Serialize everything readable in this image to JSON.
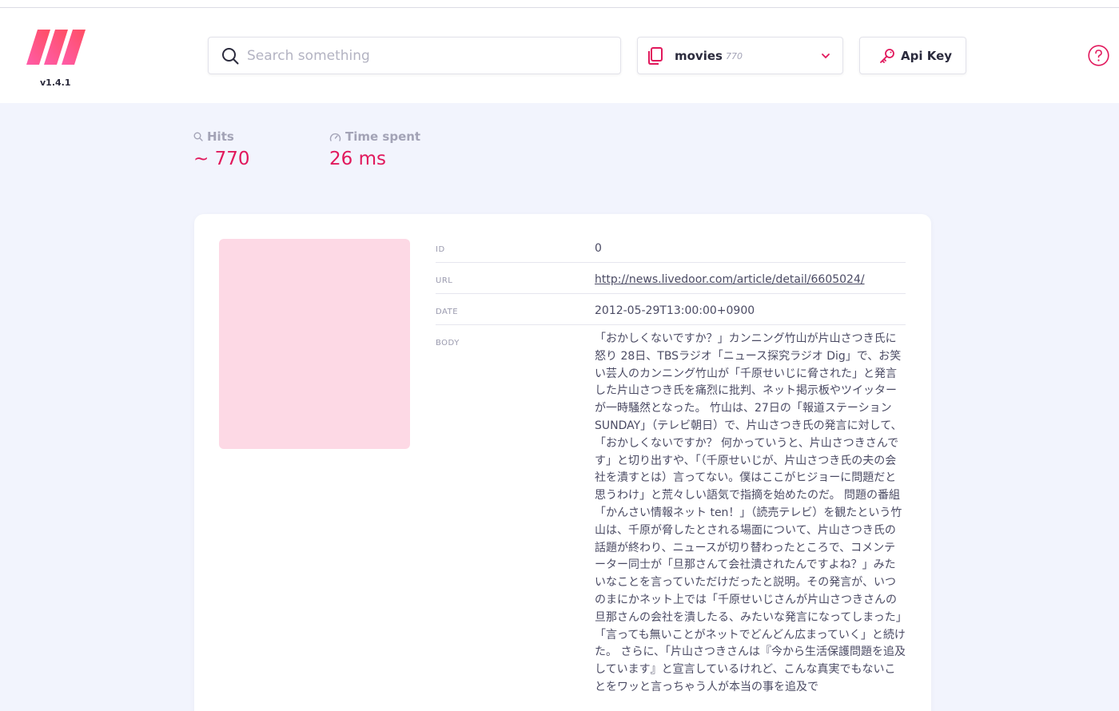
{
  "header": {
    "version": "v1.4.1",
    "search_placeholder": "Search something",
    "index": {
      "name": "movies",
      "count": "770"
    },
    "api_key_label": "Api Key"
  },
  "stats": {
    "hits_label": "Hits",
    "hits_value": "~ 770",
    "time_label": "Time spent",
    "time_value": "26 ms"
  },
  "document": {
    "fields": [
      {
        "key": "ID",
        "value": "0"
      },
      {
        "key": "URL",
        "value": "http://news.livedoor.com/article/detail/6605024/"
      },
      {
        "key": "DATE",
        "value": "2012-05-29T13:00:00+0900"
      },
      {
        "key": "BODY",
        "value": "「おかしくないですか？」カンニング竹山が片山さつき氏に怒り 28日、TBSラジオ「ニュース探究ラジオ Dig」で、お笑い芸人のカンニング竹山が「千原せいじに脅された」と発言した片山さつき氏を痛烈に批判、ネット掲示板やツイッターが一時騒然となった。 竹山は、27日の「報道ステーションSUNDAY」（テレビ朝日）で、片山さつき氏の発言に対して、「おかしくないですか？ 何かっていうと、片山さつきさんです」と切り出すや、「（千原せいじが、片山さつき氏の夫の会社を潰すとは）言ってない。僕はここがヒジョーに問題だと思うわけ」と荒々しい語気で指摘を始めたのだ。 問題の番組「かんさい情報ネット ten！」（読売テレビ）を観たという竹山は、千原が脅したとされる場面について、片山さつき氏の話題が終わり、ニュースが切り替わったところで、コメンテーター同士が「旦那さんて会社潰されたんですよね？」みたいなことを言っていただけだったと説明。その発言が、いつのまにかネット上では「千原せいじさんが片山さつきさんの旦那さんの会社を潰したる、みたいな発言になってしまった」「言っても無いことがネットでどんどん広まっていく」と続けた。 さらに、「片山さつきさんは『今から生活保護問題を追及しています』と宣言しているけれど、こんな真実でもないことをワッと言っちゃう人が本当の事を追及で"
      }
    ]
  },
  "colors": {
    "accent": "#e1185c",
    "thumb": "#fdd9e5"
  }
}
